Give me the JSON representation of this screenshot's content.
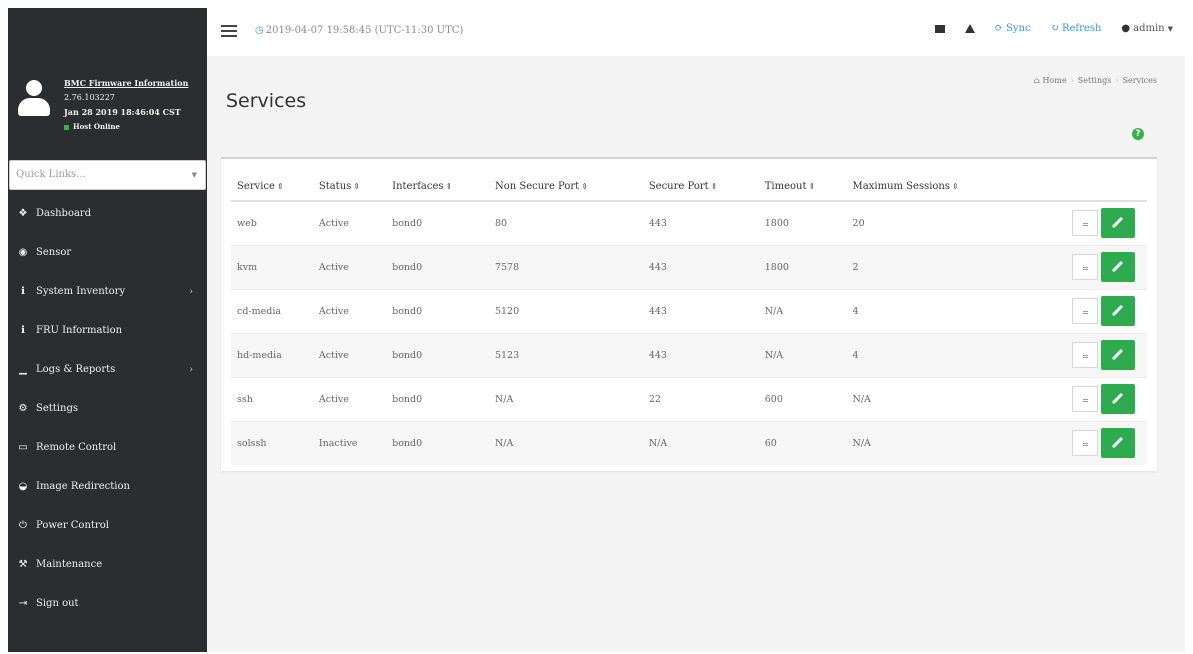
{
  "sidebar": {
    "profile": {
      "line1": "BMC Firmware Information",
      "line2": "2.76.103227",
      "line3": "Jan 28 2019 18:46:04 CST",
      "status": "Host Online",
      "status_color": "#35b34a"
    },
    "quick_links_placeholder": "Quick Links...",
    "items": [
      {
        "label": "Dashboard",
        "icon": "dashboard-icon",
        "glyph": "❖",
        "has_submenu": false
      },
      {
        "label": "Sensor",
        "icon": "sensor-icon",
        "glyph": "◉",
        "has_submenu": false
      },
      {
        "label": "System Inventory",
        "icon": "info-icon",
        "glyph": "ℹ",
        "has_submenu": true
      },
      {
        "label": "FRU Information",
        "icon": "info-icon",
        "glyph": "ℹ",
        "has_submenu": false
      },
      {
        "label": "Logs & Reports",
        "icon": "bar-chart-icon",
        "glyph": "▁",
        "has_submenu": true
      },
      {
        "label": "Settings",
        "icon": "gear-icon",
        "glyph": "⚙",
        "has_submenu": false
      },
      {
        "label": "Remote Control",
        "icon": "monitor-icon",
        "glyph": "▭",
        "has_submenu": false
      },
      {
        "label": "Image Redirection",
        "icon": "disc-icon",
        "glyph": "◒",
        "has_submenu": false
      },
      {
        "label": "Power Control",
        "icon": "power-icon",
        "glyph": "⏻",
        "has_submenu": false
      },
      {
        "label": "Maintenance",
        "icon": "wrench-icon",
        "glyph": "⚒",
        "has_submenu": false
      },
      {
        "label": "Sign out",
        "icon": "sign-out-icon",
        "glyph": "⇥",
        "has_submenu": false
      }
    ]
  },
  "topbar": {
    "datetime": "2019-04-07 19:58:45 (UTC-11:30 UTC)",
    "sync_label": "Sync",
    "refresh_label": "Refresh",
    "user_label": "admin",
    "accent_color": "#3a9ad9"
  },
  "page": {
    "title": "Services",
    "breadcrumb": [
      "Home",
      "Settings",
      "Services"
    ],
    "help_glyph": "?"
  },
  "table": {
    "columns": [
      "Service",
      "Status",
      "Interfaces",
      "Non Secure Port",
      "Secure Port",
      "Timeout",
      "Maximum Sessions"
    ],
    "rows": [
      [
        "web",
        "Active",
        "bond0",
        "80",
        "443",
        "1800",
        "20"
      ],
      [
        "kvm",
        "Active",
        "bond0",
        "7578",
        "443",
        "1800",
        "2"
      ],
      [
        "cd-media",
        "Active",
        "bond0",
        "5120",
        "443",
        "N/A",
        "4"
      ],
      [
        "hd-media",
        "Active",
        "bond0",
        "5123",
        "443",
        "N/A",
        "4"
      ],
      [
        "ssh",
        "Active",
        "bond0",
        "N/A",
        "22",
        "600",
        "N/A"
      ],
      [
        "solssh",
        "Inactive",
        "bond0",
        "N/A",
        "N/A",
        "60",
        "N/A"
      ]
    ],
    "edit_button_color": "#2fab4f"
  }
}
